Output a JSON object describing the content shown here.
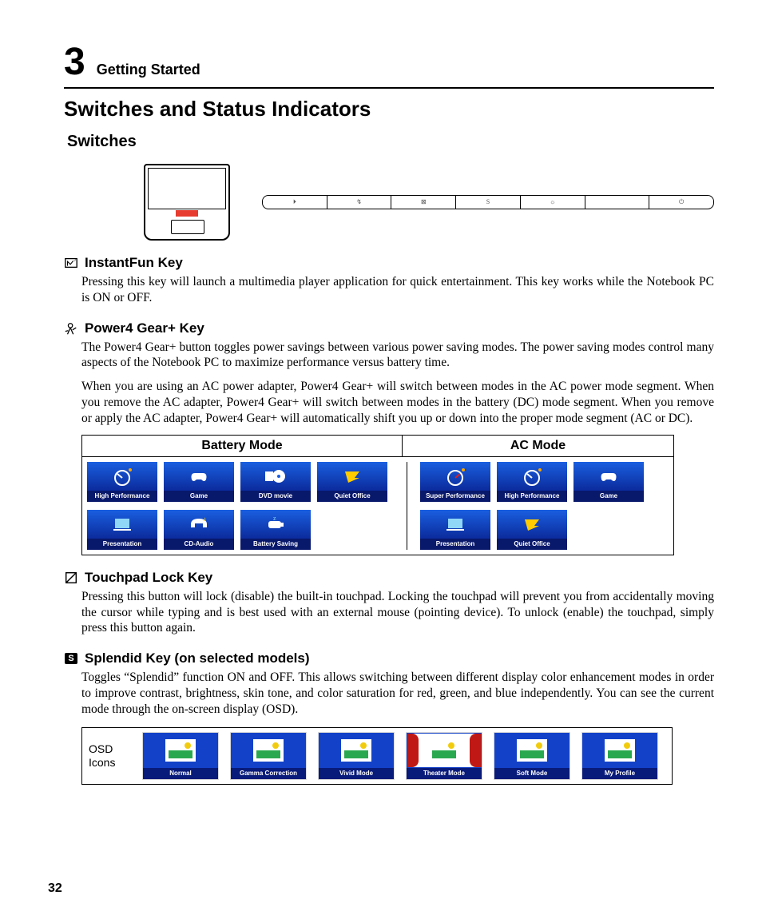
{
  "chapter": {
    "number": "3",
    "title": "Getting Started"
  },
  "h1": "Switches and Status Indicators",
  "h2": "Switches",
  "page_number": "32",
  "bar_icons": [
    "⏵",
    "↯",
    "⊠",
    "S",
    "☼",
    "",
    "⏻"
  ],
  "sections": {
    "instantfun": {
      "title": "InstantFun Key",
      "body": "Pressing this key will launch a multimedia player application for quick entertainment. This key works while the Notebook PC is ON or OFF."
    },
    "power4": {
      "title": "Power4 Gear+ Key",
      "body1": "The Power4 Gear+ button toggles power savings between various power saving modes. The power saving modes control many aspects of the Notebook PC to maximize performance versus battery time.",
      "body2": "When you are using an AC power adapter, Power4 Gear+ will switch between modes in the AC power mode segment. When you remove the AC adapter, Power4 Gear+ will switch between modes in the battery (DC) mode segment. When you remove or apply the AC adapter, Power4 Gear+ will automatically shift you up or down into the proper mode segment (AC or DC).",
      "table": {
        "headers": [
          "Battery Mode",
          "AC Mode"
        ],
        "battery": [
          "High Performance",
          "Game",
          "DVD movie",
          "Quiet Office",
          "Presentation",
          "CD-Audio",
          "Battery Saving"
        ],
        "ac": [
          "Super Performance",
          "High Performance",
          "Game",
          "Presentation",
          "Quiet Office"
        ]
      }
    },
    "touchpad": {
      "title": "Touchpad Lock Key",
      "body": "Pressing this button will lock (disable) the built-in touchpad. Locking the touchpad will prevent you from accidentally moving the cursor while typing and is best used with an external mouse (pointing device). To unlock (enable) the touchpad, simply press this button again."
    },
    "splendid": {
      "title": "Splendid Key (on selected models)",
      "body": "Toggles “Splendid” function ON and OFF. This allows switching between different display color enhancement modes in order to improve contrast, brightness, skin tone, and color saturation for red, green, and blue independently. You can see the current mode through the on-screen display (OSD).",
      "osd_label": "OSD Icons",
      "osd": [
        "Normal",
        "Gamma Correction",
        "Vivid Mode",
        "Theater Mode",
        "Soft Mode",
        "My Profile"
      ]
    }
  }
}
